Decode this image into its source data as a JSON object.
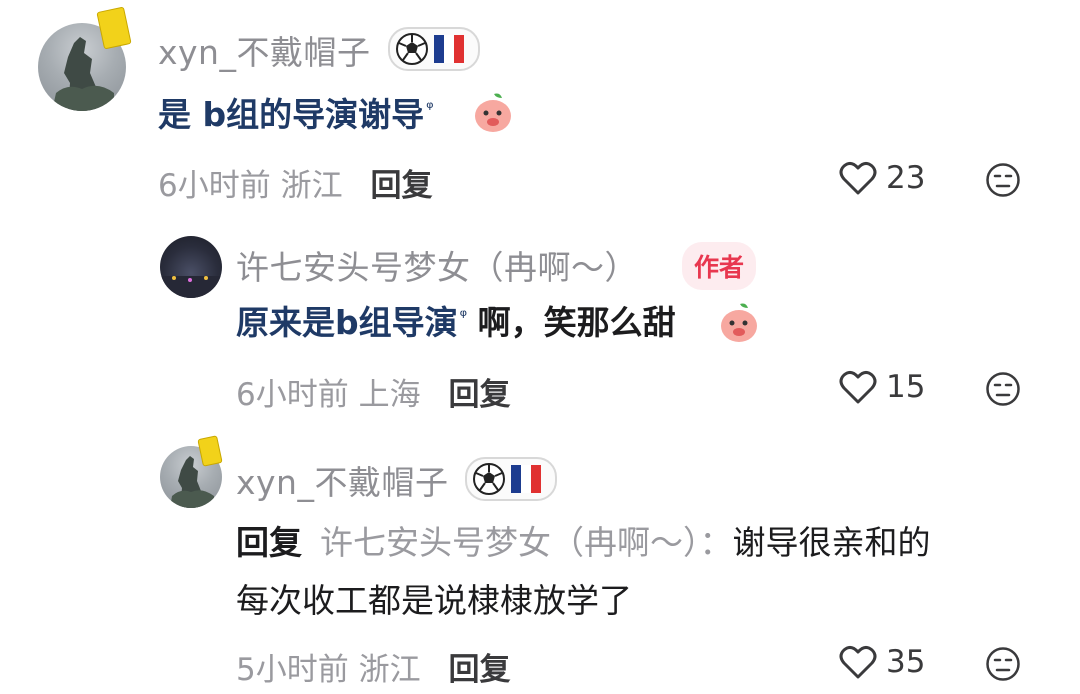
{
  "comments": [
    {
      "username": "xyn_不戴帽子",
      "text_link": "是 b组的导演谢导",
      "text_rest": "",
      "search_mark": "ᵠ",
      "time": "6小时前",
      "location": "浙江",
      "reply_label": "回复",
      "likes": "23",
      "badge_icons": [
        "soccer-ball-icon",
        "france-flag-icon"
      ]
    },
    {
      "username": "许七安头号梦女（冉啊～）",
      "author_tag": "作者",
      "text_link": "原来是b组导演",
      "text_rest": "啊，笑那么甜",
      "search_mark": "ᵠ",
      "time": "6小时前",
      "location": "上海",
      "reply_label": "回复",
      "likes": "15"
    },
    {
      "username": "xyn_不戴帽子",
      "reply_prefix": "回复",
      "reply_target": "许七安头号梦女（冉啊～）：",
      "text_line1": "谢导很亲和的",
      "text_line2": "每次收工都是说棣棣放学了",
      "time": "5小时前",
      "location": "浙江",
      "reply_label": "回复",
      "likes": "35",
      "badge_icons": [
        "soccer-ball-icon",
        "france-flag-icon"
      ]
    }
  ],
  "colors": {
    "link": "#1f3a66",
    "username": "#8e8e93",
    "author_tag_text": "#e8374f",
    "author_tag_bg": "#fdecef",
    "meta": "#9a9a9f"
  }
}
